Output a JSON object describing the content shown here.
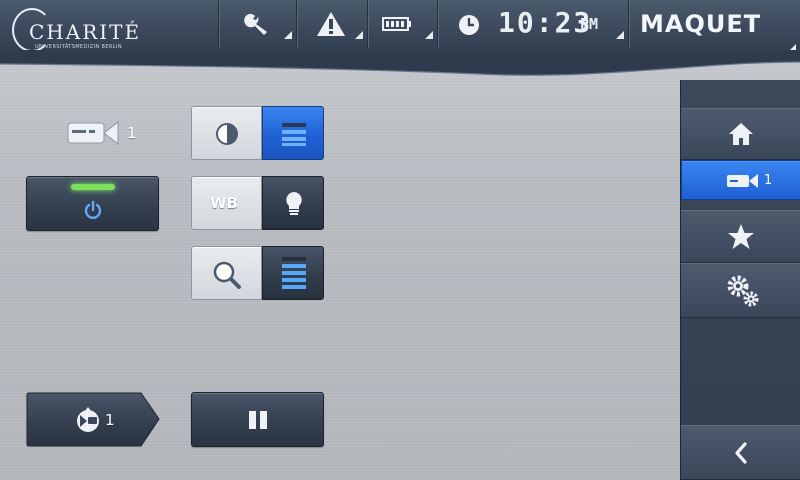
{
  "header": {
    "logo_name": "CHARITÉ",
    "logo_subtitle": "UNIVERSITÄTSMEDIZIN BERLIN",
    "tools": [
      "wrench-icon",
      "warning-icon",
      "battery-icon"
    ],
    "clock": {
      "icon": "clock-icon",
      "time": "10:23",
      "ampm": "PM"
    },
    "brand": "MAQUET"
  },
  "camera": {
    "icon": "camera-icon",
    "number": "1",
    "power_icon": "power-icon",
    "power_indicator_color": "#7ee05a"
  },
  "controls": {
    "contrast": {
      "icon": "contrast-icon",
      "level_icon": "level-bars-icon",
      "active": "level"
    },
    "white_balance": {
      "label": "WB",
      "icon": "light-bulb-icon"
    },
    "zoom": {
      "icon": "magnifier-icon",
      "level_icon": "level-bars-icon",
      "level_segments_lit": 5
    }
  },
  "footer": {
    "source_number": "1",
    "source_icon": "source-select-icon",
    "pause_icon": "pause-icon"
  },
  "nav": {
    "items": [
      {
        "icon": "home-icon",
        "label": ""
      },
      {
        "icon": "camera-icon",
        "label": "1",
        "active": true
      },
      {
        "icon": "star-icon",
        "label": ""
      },
      {
        "icon": "gears-icon",
        "label": ""
      }
    ],
    "back_icon": "chevron-left-icon"
  },
  "colors": {
    "accent": "#2a6ee0",
    "header": "#3a475a",
    "background": "#bfc3c8"
  }
}
